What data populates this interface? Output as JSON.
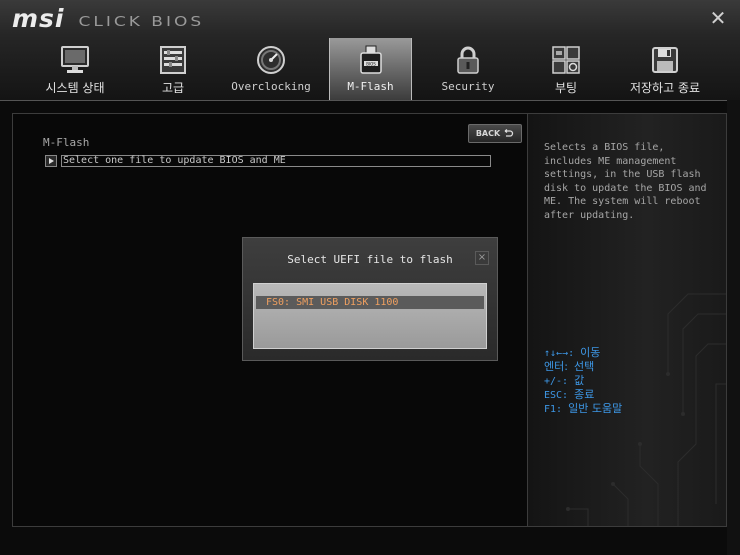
{
  "header": {
    "brand": "msi",
    "product": "CLICK BIOS",
    "close": "✕"
  },
  "tabs": [
    {
      "label": "시스템 상태",
      "icon": "monitor-icon"
    },
    {
      "label": "고급",
      "icon": "settings-panel-icon"
    },
    {
      "label": "Overclocking",
      "icon": "speedometer-icon"
    },
    {
      "label": "M-Flash",
      "icon": "usb-flash-icon",
      "active": true
    },
    {
      "label": "Security",
      "icon": "padlock-icon"
    },
    {
      "label": "부팅",
      "icon": "boot-icon"
    },
    {
      "label": "저장하고 종료",
      "icon": "floppy-disk-icon"
    }
  ],
  "main": {
    "section_title": "M-Flash",
    "back_label": "BACK",
    "menu_item": "Select one file to update BIOS and ME"
  },
  "dialog": {
    "title": "Select UEFI file to flash",
    "close": "×",
    "items": [
      "FS0: SMI USB DISK 1100"
    ]
  },
  "help": {
    "description": "Selects a BIOS file,\nincludes ME management\nsettings, in the USB flash\ndisk to update the BIOS and\nME.  The system will reboot\nafter updating.",
    "keys": [
      {
        "key": "↑↓←→:",
        "action": "이동"
      },
      {
        "key": "엔터:",
        "action": "선택"
      },
      {
        "key": "+/-:",
        "action": "값"
      },
      {
        "key": "ESC:",
        "action": "종료"
      },
      {
        "key": "F1:",
        "action": "일반 도움말"
      }
    ]
  },
  "colors": {
    "accent_blue": "#3d97e6",
    "selected_item_text": "#f0a060",
    "active_tab": "#7a7a7a"
  }
}
